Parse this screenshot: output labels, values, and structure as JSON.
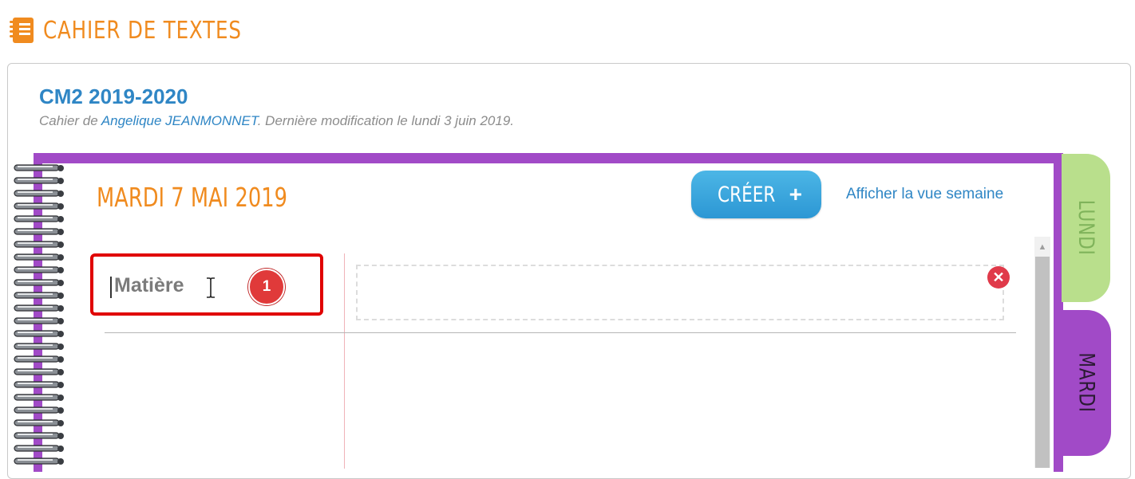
{
  "header": {
    "title": "CAHIER DE TEXTES",
    "icon": "notebook-icon",
    "color": "#f08b1f"
  },
  "cahier": {
    "class_name": "CM2 2019-2020",
    "meta_prefix": "Cahier de ",
    "author": "Angelique JEANMONNET",
    "meta_suffix": ". Dernière modification le lundi 3 juin 2019."
  },
  "day": {
    "title": "MARDI 7 MAI 2019"
  },
  "toolbar": {
    "create_label": "CRÉER",
    "create_icon": "plus-icon",
    "week_view_label": "Afficher la vue semaine"
  },
  "entry": {
    "subject_placeholder": "Matière",
    "step_badge": "1",
    "delete_icon": "close-circle-icon"
  },
  "tabs": [
    {
      "label": "LUNDI",
      "color": "#b9df8c",
      "active": false
    },
    {
      "label": "MARDI",
      "color": "#a14ac7",
      "active": true
    }
  ],
  "colors": {
    "accent_orange": "#f08b1f",
    "accent_blue": "#2f86c5",
    "notebook_purple": "#a14ac7",
    "highlight_red": "#e00000"
  }
}
